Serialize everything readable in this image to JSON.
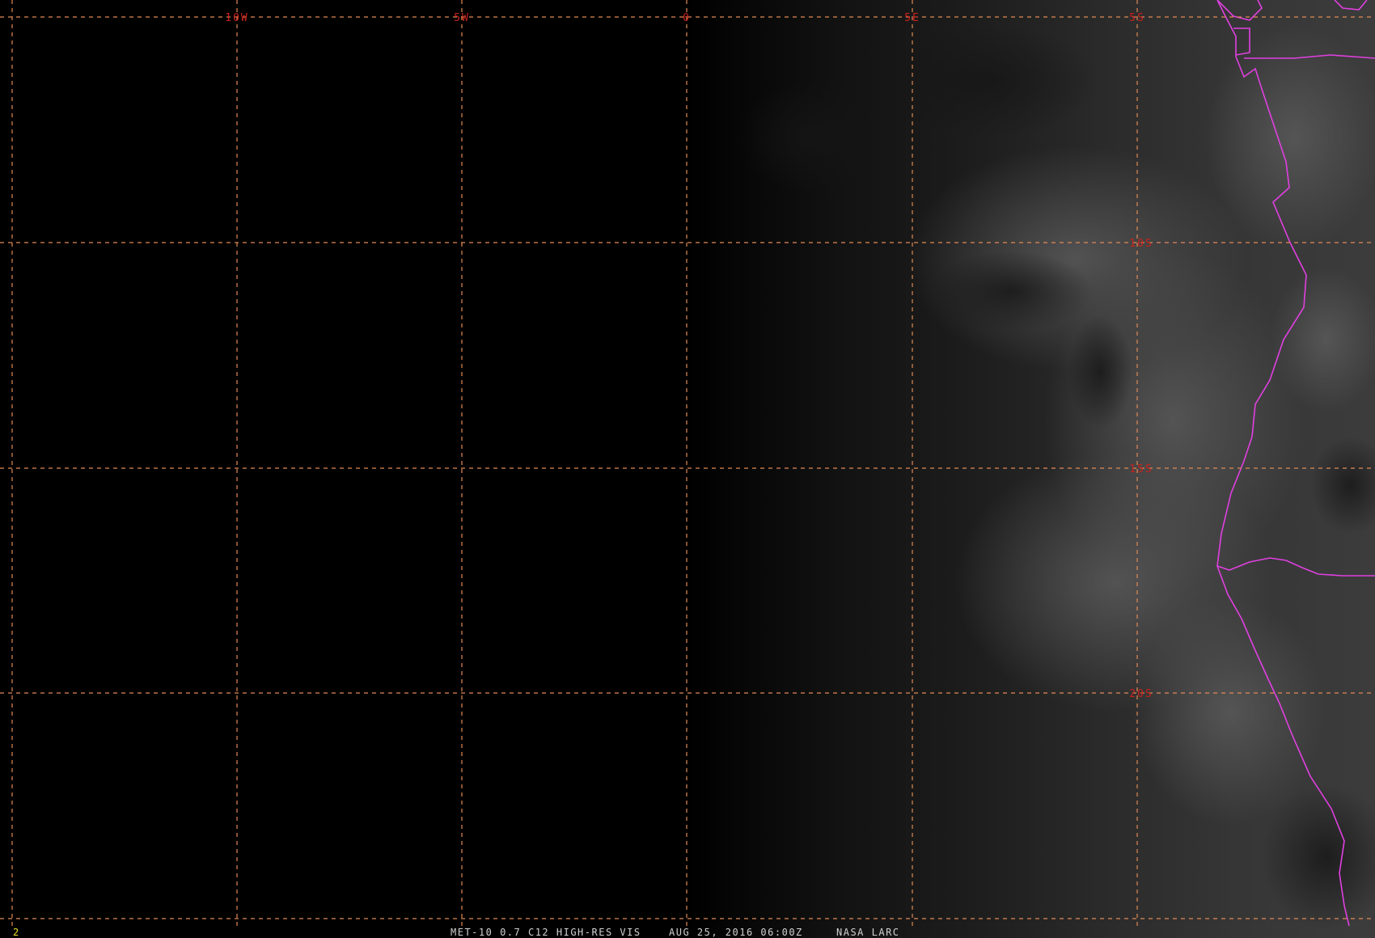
{
  "map": {
    "graticule": {
      "longitude_labels": [
        "10W",
        "5W",
        "0",
        "5E",
        "5S"
      ],
      "latitude_labels": [
        "10S",
        "15S",
        "20S"
      ]
    },
    "colors": {
      "background": "#000000",
      "graticule": "#e08a55",
      "graticule_labels": "#c8221c",
      "political_borders": "#e040e0",
      "status_text": "#d0d0d0",
      "frame_number": "#e8e020"
    }
  },
  "status_bar": {
    "frame_number": "2",
    "product": "MET-10 0.7 C12 HIGH-RES VIS",
    "timestamp": "AUG 25, 2016 06:00Z",
    "source": "NASA LARC"
  }
}
